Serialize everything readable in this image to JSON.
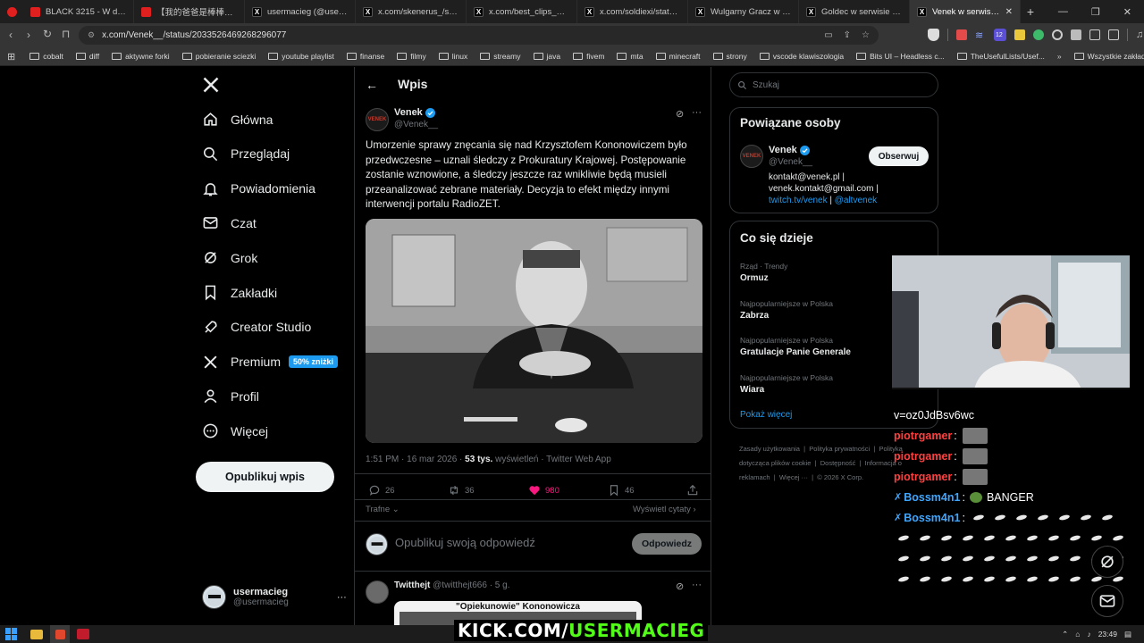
{
  "browser": {
    "tabs": [
      {
        "title": "BLACK 3215 - W dup",
        "favicon_color": "#e01f1f"
      },
      {
        "title": "【我的爸爸是棒棒】歡樂了",
        "favicon_color": "#e01f1f"
      },
      {
        "title": "usermacieg (@usermacieg",
        "favicon_color": "#000000"
      },
      {
        "title": "x.com/skenerus_/status/20",
        "favicon_color": "#000000"
      },
      {
        "title": "x.com/best_clips__/status",
        "favicon_color": "#000000"
      },
      {
        "title": "x.com/soldiexi/status/203",
        "favicon_color": "#000000"
      },
      {
        "title": "Wulgarny Gracz w serwis",
        "favicon_color": "#000000"
      },
      {
        "title": "Goldec w serwisie X: „",
        "favicon_color": "#000000"
      },
      {
        "title": "Venek w serwisie X: „No",
        "favicon_color": "#000000"
      }
    ],
    "url": "x.com/Venek__/status/2033526469268296077",
    "bookmarks": [
      "cobalt",
      "diff",
      "aktywne forki",
      "pobieranie sciezki",
      "youtube playlist",
      "finanse",
      "filmy",
      "linux",
      "streamy",
      "java",
      "fivem",
      "mta",
      "minecraft",
      "strony",
      "vscode klawiszologia",
      "Bits UI – Headless c...",
      "TheUsefulLists/Usef..."
    ],
    "all_bookmarks": "Wszystkie zakładki",
    "extension_badge": "12"
  },
  "nav": {
    "items": [
      {
        "label": "Główna",
        "icon": "home-icon"
      },
      {
        "label": "Przeglądaj",
        "icon": "search-icon"
      },
      {
        "label": "Powiadomienia",
        "icon": "bell-icon"
      },
      {
        "label": "Czat",
        "icon": "mail-icon"
      },
      {
        "label": "Grok",
        "icon": "grok-icon"
      },
      {
        "label": "Zakładki",
        "icon": "bookmark-icon"
      },
      {
        "label": "Creator Studio",
        "icon": "rocket-icon"
      },
      {
        "label": "Premium",
        "icon": "x-logo-icon"
      },
      {
        "label": "Profil",
        "icon": "person-icon"
      },
      {
        "label": "Więcej",
        "icon": "more-circle-icon"
      }
    ],
    "premium_badge": "50% zniżki",
    "post_button": "Opublikuj wpis",
    "account": {
      "name": "usermacieg",
      "handle": "@usermacieg"
    }
  },
  "post": {
    "header": "Wpis",
    "author": {
      "name": "Venek",
      "handle": "@Venek__"
    },
    "text": "Umorzenie sprawy znęcania się nad Krzysztofem Kononowiczem było przedwczesne – uznali śledczy z Prokuratury Krajowej. Postępowanie zostanie wznowione, a śledczy jeszcze raz wnikliwie będą musieli przeanalizować zebrane materiały. Decyzja to efekt między innymi interwencji portalu RadioZET.",
    "meta_time": "1:51 PM · 16 mar 2026 · ",
    "meta_views": "53 tys.",
    "meta_views_label": " wyświetleń · Twitter Web App",
    "replies": "26",
    "reposts": "36",
    "likes": "980",
    "bookmarks": "46",
    "like_color": "#f91880",
    "sort_label": "Trafne",
    "show_quotes": "Wyświetl cytaty",
    "reply_placeholder": "Opublikuj swoją odpowiedź",
    "reply_button": "Odpowiedz"
  },
  "reply": {
    "name": "Twitthejt",
    "handle": "@twitthejt666",
    "time": "· 5 g.",
    "image_caption": "\"Opiekunowie\" Kononowicza"
  },
  "right": {
    "search_placeholder": "Szukaj",
    "related_title": "Powiązane osoby",
    "related": {
      "name": "Venek",
      "handle": "@Venek__",
      "follow": "Obserwuj",
      "bio1": "kontakt@venek.pl |",
      "bio2": "venek.kontakt@gmail.com |",
      "bio_link1": "twitch.tv/venek",
      "bio_sep": " | ",
      "bio_link2": "@altvenek"
    },
    "trends_title": "Co się dzieje",
    "trends": [
      {
        "category": "Rząd · Trendy",
        "name": "Ormuz"
      },
      {
        "category": "Najpopularniejsze w Polska",
        "name": "Zabrza"
      },
      {
        "category": "Najpopularniejsze w Polska",
        "name": "Gratulacje Panie Generale"
      },
      {
        "category": "Najpopularniejsze w Polska",
        "name": "Wiara"
      }
    ],
    "show_more": "Pokaż więcej",
    "footer": [
      "Zasady użytkowania",
      "Polityka prywatności",
      "Polityka dotycząca plików cookie",
      "Dostępność",
      "Informacja o reklamach",
      "Więcej ···",
      "© 2026 X Corp."
    ]
  },
  "stream": {
    "chat": [
      {
        "user": "",
        "text": "v=oz0JdBsv6wc"
      },
      {
        "user": "piotrgamer",
        "text": ""
      },
      {
        "user": "piotrgamer",
        "text": ""
      },
      {
        "user": "piotrgamer",
        "text": ""
      },
      {
        "user": "Bossm4n1",
        "text": "BANGER"
      },
      {
        "user": "Bossm4n1",
        "text": ""
      }
    ],
    "kick_prefix": "KICK.COM/",
    "kick_name": "USERMACIEG"
  },
  "taskbar": {
    "time": "23:49"
  }
}
